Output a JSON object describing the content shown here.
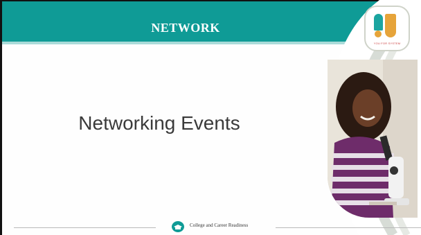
{
  "slide": {
    "header_title": "NETWORK",
    "main_heading": "Networking Events",
    "logo_text": "YOU FOR SYSTEM",
    "footer_label": "College and Career Readiness"
  },
  "colors": {
    "header_teal": "#0f9b96",
    "logo_teal": "#1ba5a0",
    "logo_orange": "#e6a43a",
    "heading_gray": "#3a3a3a"
  },
  "icons": {
    "logo": "brand-logo-icon",
    "footer": "graduation-cap-icon"
  }
}
